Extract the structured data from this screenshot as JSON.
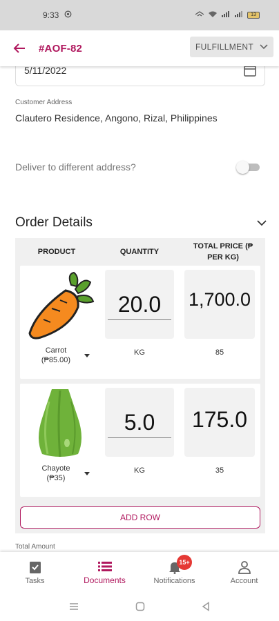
{
  "status_bar": {
    "time": "9:33",
    "battery": "13"
  },
  "header": {
    "order_id": "#AOF-82",
    "status": "FULFILLMENT"
  },
  "form": {
    "date_value": "5/11/2022",
    "customer_address_label": "Customer Address",
    "customer_address_value": "Clautero Residence, Angono, Rizal, Philippines",
    "deliver_label": "Deliver to different address?",
    "deliver_toggle_on": false
  },
  "order_details": {
    "title": "Order Details",
    "columns": {
      "product": "PRODUCT",
      "quantity": "QUANTITY",
      "total_price_line1": "TOTAL PRICE (₱",
      "total_price_line2": "PER KG)"
    },
    "rows": [
      {
        "name": "Carrot",
        "price": "(₱85.00)",
        "quantity": "20.0",
        "unit": "KG",
        "total": "1,700.0",
        "unit_price": "85",
        "image": "carrot-image"
      },
      {
        "name": "Chayote",
        "price": "(₱35)",
        "quantity": "5.0",
        "unit": "KG",
        "total": "175.0",
        "unit_price": "35",
        "image": "chayote-image"
      }
    ],
    "add_row_label": "ADD ROW"
  },
  "total_amount_label": "Total Amount",
  "bottom_nav": {
    "items": [
      {
        "label": "Tasks",
        "icon": "task-clipboard-icon"
      },
      {
        "label": "Documents",
        "icon": "documents-list-icon"
      },
      {
        "label": "Notifications",
        "icon": "bell-icon",
        "badge": "15+"
      },
      {
        "label": "Account",
        "icon": "person-icon"
      }
    ],
    "active_index": 1
  },
  "colors": {
    "accent": "#b0185e",
    "badge": "#e53935",
    "status_bar": "#d9d9d9"
  }
}
